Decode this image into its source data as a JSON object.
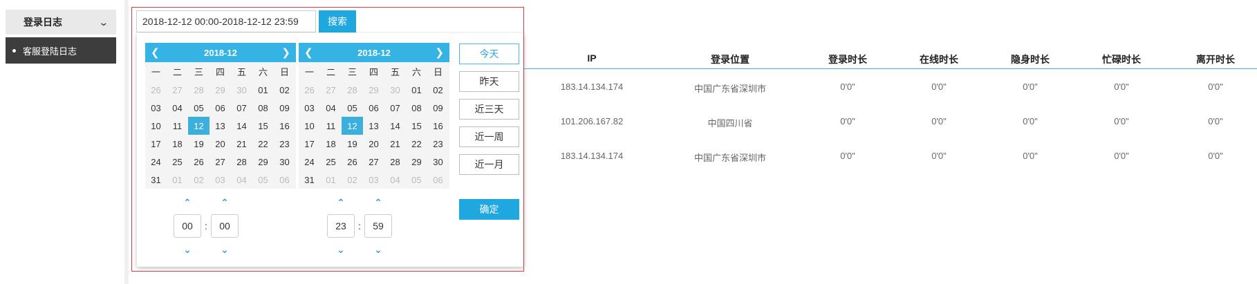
{
  "sidebar": {
    "group_label": "登录日志",
    "item_label": "客服登陆日志"
  },
  "search": {
    "value": "2018-12-12 00:00-2018-12-12 23:59",
    "button_label": "搜索"
  },
  "picker": {
    "weekdays": [
      "一",
      "二",
      "三",
      "四",
      "五",
      "六",
      "日"
    ],
    "left": {
      "title": "2018-12",
      "days": [
        "26",
        "27",
        "28",
        "29",
        "30",
        "01",
        "02",
        "03",
        "04",
        "05",
        "06",
        "07",
        "08",
        "09",
        "10",
        "11",
        "12",
        "13",
        "14",
        "15",
        "16",
        "17",
        "18",
        "19",
        "20",
        "21",
        "22",
        "23",
        "24",
        "25",
        "26",
        "27",
        "28",
        "29",
        "30",
        "31",
        "01",
        "02",
        "03",
        "04",
        "05",
        "06"
      ],
      "hour": "00",
      "minute": "00"
    },
    "right": {
      "title": "2018-12",
      "days": [
        "26",
        "27",
        "28",
        "29",
        "30",
        "01",
        "02",
        "03",
        "04",
        "05",
        "06",
        "07",
        "08",
        "09",
        "10",
        "11",
        "12",
        "13",
        "14",
        "15",
        "16",
        "17",
        "18",
        "19",
        "20",
        "21",
        "22",
        "23",
        "24",
        "25",
        "26",
        "27",
        "28",
        "29",
        "30",
        "31",
        "01",
        "02",
        "03",
        "04",
        "05",
        "06"
      ],
      "hour": "23",
      "minute": "59"
    },
    "quick": [
      "今天",
      "昨天",
      "近三天",
      "近一周",
      "近一月"
    ],
    "confirm_label": "确定"
  },
  "table": {
    "headers": [
      "IP",
      "登录位置",
      "登录时长",
      "在线时长",
      "隐身时长",
      "忙碌时长",
      "离开时长"
    ],
    "rows": [
      [
        "183.14.134.174",
        "中国广东省深圳市",
        "0'0\"",
        "0'0\"",
        "0'0\"",
        "0'0\"",
        "0'0\""
      ],
      [
        "101.206.167.82",
        "中国四川省",
        "0'0\"",
        "0'0\"",
        "0'0\"",
        "0'0\"",
        "0'0\""
      ],
      [
        "183.14.134.174",
        "中国广东省深圳市",
        "0'0\"",
        "0'0\"",
        "0'0\"",
        "0'0\"",
        "0'0\""
      ]
    ]
  },
  "colors": {
    "accent": "#1fa8e0",
    "selected_day": "#3cb0dd",
    "sidebar_active": "#3d3d3d",
    "frame_red": "#e23a3a"
  }
}
